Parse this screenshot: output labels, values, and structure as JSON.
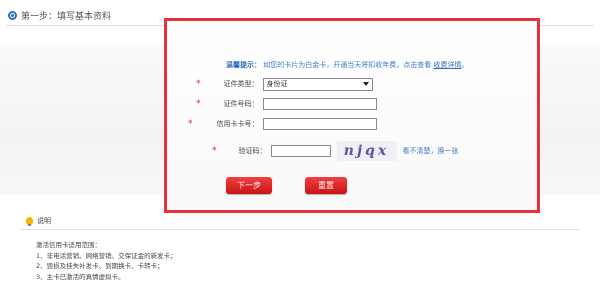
{
  "step": {
    "title": "第一步：填写基本资料"
  },
  "form": {
    "tip_label": "温馨提示：",
    "tip_text": "如您的卡片为白金卡，开通当天将扣收年费，点击查看",
    "tip_link": "收费详情",
    "tip_end": "。",
    "fields": [
      {
        "label": "证件类型：",
        "value": "身份证"
      },
      {
        "label": "证件号码：",
        "value": ""
      },
      {
        "label": "信用卡卡号：",
        "value": ""
      },
      {
        "label": "验证码：",
        "value": ""
      }
    ],
    "captcha_text": "njqx",
    "captcha_refresh": "看不清楚，换一张",
    "next_button": "下一步",
    "reset_button": "重置"
  },
  "notes": {
    "title": "说明",
    "lines": [
      "激活信用卡适用范围：",
      "1、非电话营销、网络营销、交保证金的新发卡；",
      "2、毁损及挂失补发卡、到期换卡、卡转卡；",
      "3、主卡已激活的真情虚拟卡。"
    ]
  },
  "colors": {
    "accent_red": "#e63238",
    "link_blue": "#3b7bc8"
  }
}
